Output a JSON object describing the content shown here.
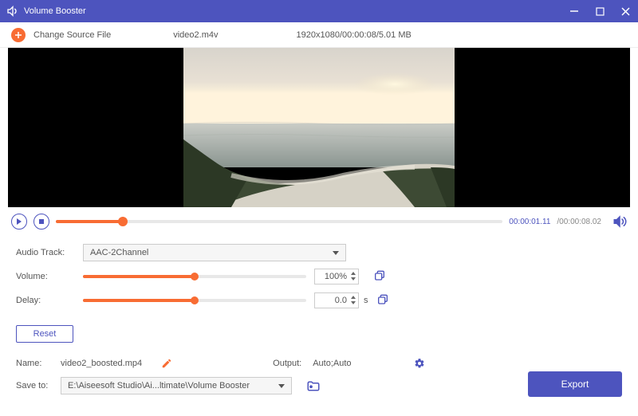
{
  "titlebar": {
    "title": "Volume Booster"
  },
  "toolbar": {
    "change_source_label": "Change Source File",
    "filename": "video2.m4v",
    "meta": "1920x1080/00:00:08/5.01 MB"
  },
  "playback": {
    "progress_pct": 15,
    "time_current": "00:00:01.11",
    "time_total": "/00:00:08.02"
  },
  "settings": {
    "audio_track_label": "Audio Track:",
    "audio_track_value": "AAC-2Channel",
    "volume_label": "Volume:",
    "volume_value": "100%",
    "volume_pct": 50,
    "delay_label": "Delay:",
    "delay_value": "0.0",
    "delay_unit": "s",
    "delay_pct": 50
  },
  "reset_label": "Reset",
  "bottom": {
    "name_label": "Name:",
    "name_value": "video2_boosted.mp4",
    "output_label": "Output:",
    "output_value": "Auto;Auto",
    "saveto_label": "Save to:",
    "saveto_value": "E:\\Aiseesoft Studio\\Ai...ltimate\\Volume Booster",
    "export_label": "Export"
  }
}
